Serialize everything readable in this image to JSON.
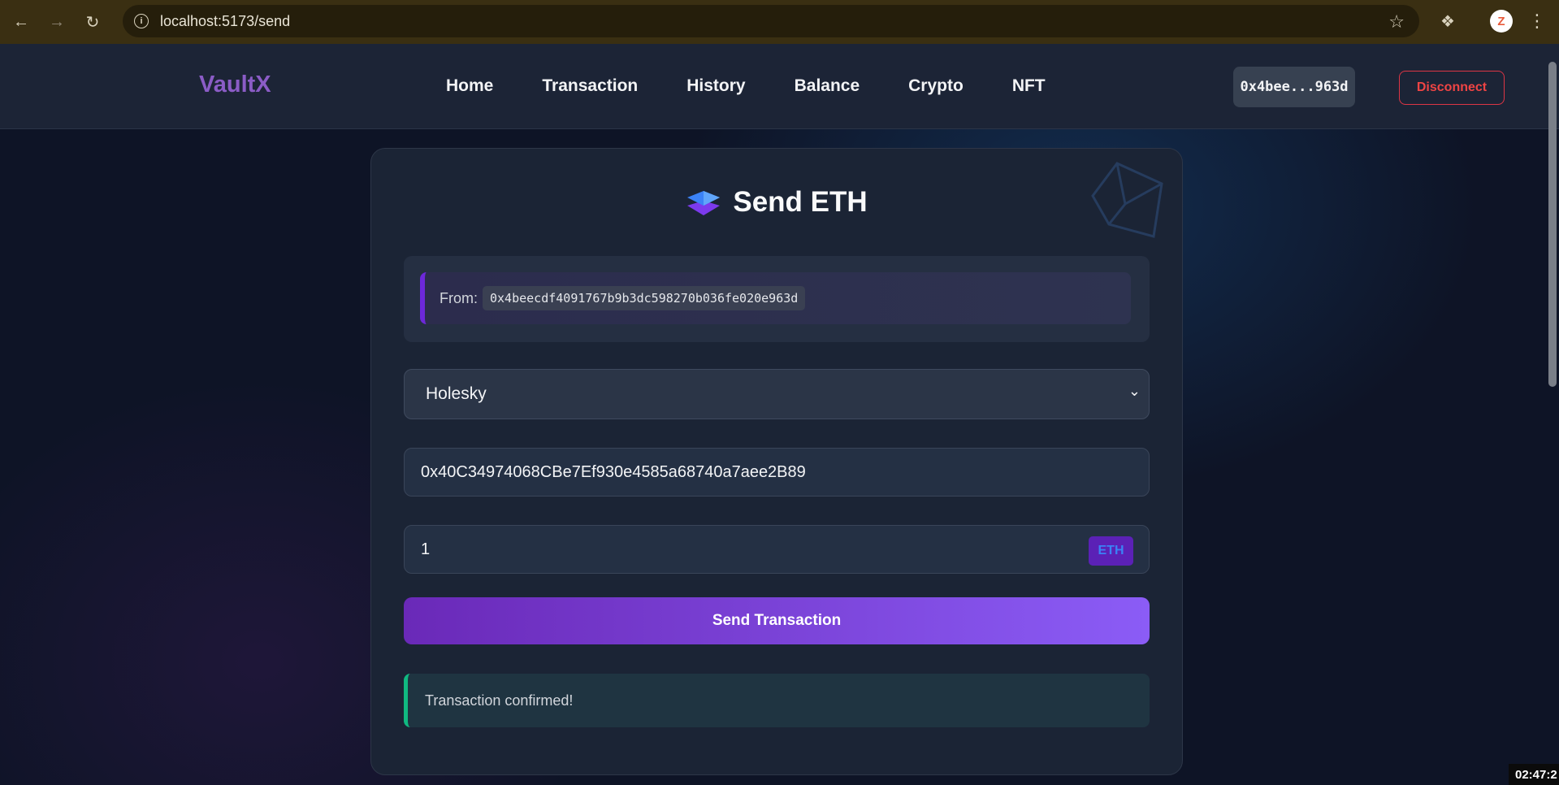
{
  "browser": {
    "url": "localhost:5173/send"
  },
  "app": {
    "brand": "VaultX",
    "nav": [
      "Home",
      "Transaction",
      "History",
      "Balance",
      "Crypto",
      "NFT"
    ],
    "wallet_short": "0x4bee...963d",
    "disconnect_label": "Disconnect"
  },
  "send_form": {
    "title": "Send ETH",
    "from_label": "From:",
    "from_address": "0x4beecdf4091767b9b3dc598270b036fe020e963d",
    "network": "Holesky",
    "recipient": "0x40C34974068CBe7Ef930e4585a68740a7aee2B89",
    "amount": "1",
    "unit": "ETH",
    "submit_label": "Send Transaction",
    "status_message": "Transaction confirmed!"
  },
  "taskbar": {
    "clock": "02:47:2"
  },
  "colors": {
    "accent": "#8b5cc6",
    "button_gradient_start": "#6a29b8",
    "button_gradient_end": "#8b5cf6",
    "success": "#10b981",
    "danger": "#ef4444"
  }
}
